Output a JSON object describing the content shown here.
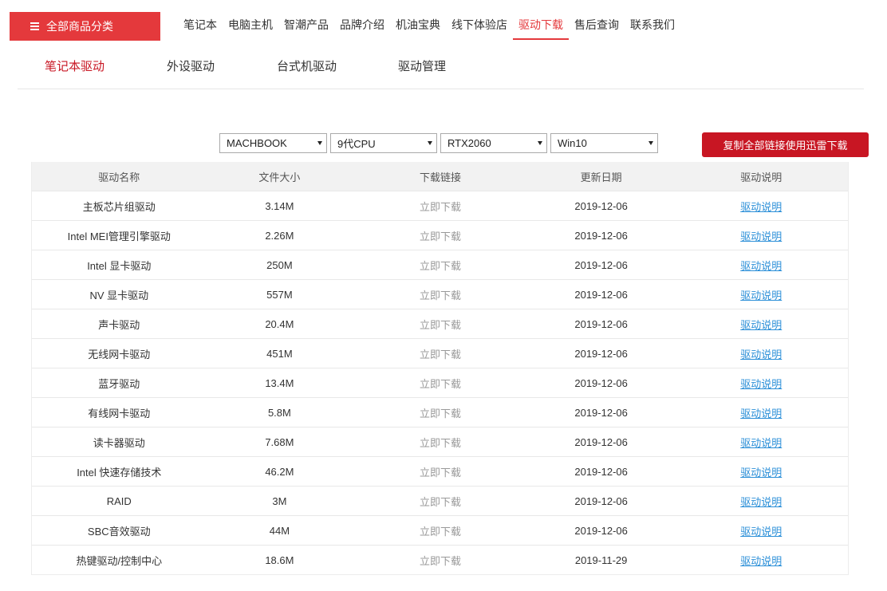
{
  "header": {
    "category_button": "全部商品分类",
    "nav": [
      "笔记本",
      "电脑主机",
      "智潮产品",
      "品牌介绍",
      "机油宝典",
      "线下体验店",
      "驱动下载",
      "售后查询",
      "联系我们"
    ],
    "active_nav_index": 6
  },
  "subtabs": [
    "笔记本驱动",
    "外设驱动",
    "台式机驱动",
    "驱动管理"
  ],
  "active_subtab_index": 0,
  "filters": {
    "model": "MACHBOOK",
    "cpu": "9代CPU",
    "gpu": "RTX2060",
    "os": "Win10"
  },
  "download_all_label": "复制全部链接使用迅雷下载",
  "table": {
    "columns": [
      "驱动名称",
      "文件大小",
      "下载链接",
      "更新日期",
      "驱动说明"
    ],
    "download_label": "立即下载",
    "desc_label": "驱动说明",
    "rows": [
      {
        "name": "主板芯片组驱动",
        "size": "3.14M",
        "date": "2019-12-06"
      },
      {
        "name": "Intel MEI管理引擎驱动",
        "size": "2.26M",
        "date": "2019-12-06"
      },
      {
        "name": "Intel 显卡驱动",
        "size": "250M",
        "date": "2019-12-06"
      },
      {
        "name": "NV 显卡驱动",
        "size": "557M",
        "date": "2019-12-06"
      },
      {
        "name": "声卡驱动",
        "size": "20.4M",
        "date": "2019-12-06"
      },
      {
        "name": "无线网卡驱动",
        "size": "451M",
        "date": "2019-12-06"
      },
      {
        "name": "蓝牙驱动",
        "size": "13.4M",
        "date": "2019-12-06"
      },
      {
        "name": "有线网卡驱动",
        "size": "5.8M",
        "date": "2019-12-06"
      },
      {
        "name": "读卡器驱动",
        "size": "7.68M",
        "date": "2019-12-06"
      },
      {
        "name": "Intel 快速存储技术",
        "size": "46.2M",
        "date": "2019-12-06"
      },
      {
        "name": "RAID",
        "size": "3M",
        "date": "2019-12-06"
      },
      {
        "name": "SBC音效驱动",
        "size": "44M",
        "date": "2019-12-06"
      },
      {
        "name": "热键驱动/控制中心",
        "size": "18.6M",
        "date": "2019-11-29"
      }
    ]
  },
  "colors": {
    "brand_red": "#e4393c",
    "dark_red": "#c81623",
    "link_blue": "#2b8fd8"
  }
}
